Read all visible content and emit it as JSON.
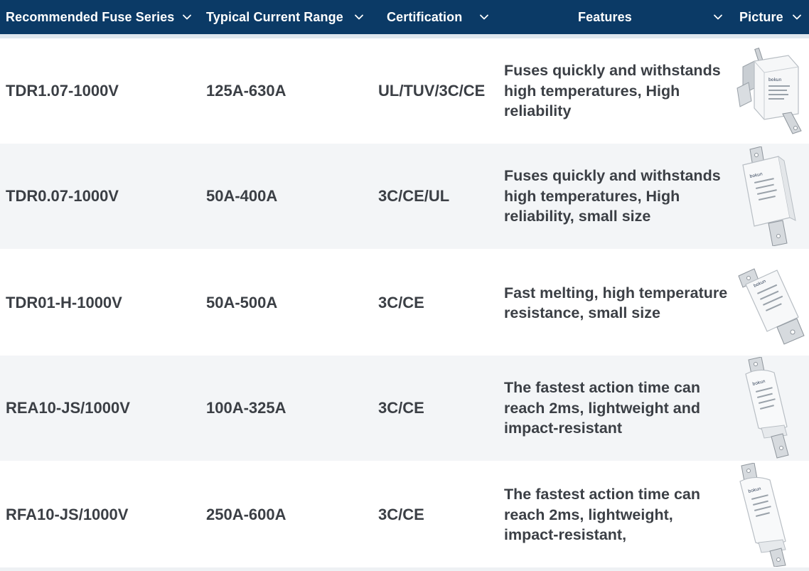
{
  "header": {
    "columns": [
      {
        "label": "Recommended Fuse Series"
      },
      {
        "label": "Typical Current Range"
      },
      {
        "label": "Certification"
      },
      {
        "label": "Features"
      },
      {
        "label": "Picture"
      }
    ]
  },
  "rows": [
    {
      "series": "TDR1.07-1000V",
      "current": "125A-630A",
      "cert": "UL/TUV/3C/CE",
      "features": "Fuses quickly and withstands high temperatures, High reliability",
      "picture": "fuse-angled-bracket-image"
    },
    {
      "series": "TDR0.07-1000V",
      "current": "50A-400A",
      "cert": "3C/CE/UL",
      "features": "Fuses quickly and withstands high temperatures, High reliability, small size",
      "picture": "fuse-square-body-image"
    },
    {
      "series": "TDR01-H-1000V",
      "current": "50A-500A",
      "cert": "3C/CE",
      "features": "Fast melting, high temperature resistance, small size",
      "picture": "fuse-flat-bolt-image"
    },
    {
      "series": "REA10-JS/1000V",
      "current": "100A-325A",
      "cert": "3C/CE",
      "features": "The fastest action time can reach 2ms, lightweight and impact-resistant",
      "picture": "fuse-cylindrical-image"
    },
    {
      "series": "RFA10-JS/1000V",
      "current": "250A-600A",
      "cert": "3C/CE",
      "features": "The fastest action time can reach 2ms, lightweight, impact-resistant,",
      "picture": "fuse-cylindrical-long-image"
    }
  ],
  "icons": {
    "sort": "chevron-down-icon"
  },
  "colors": {
    "header_bg": "#0b3a66",
    "header_text": "#ffffff",
    "row_alt_bg": "#f3f5f7",
    "cell_text": "#3b3f45"
  }
}
